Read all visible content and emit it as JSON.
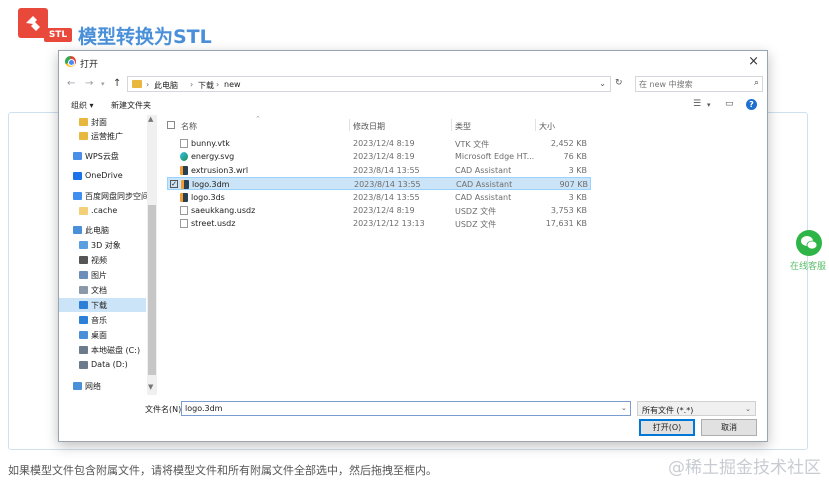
{
  "app": {
    "logo_tag": "STL",
    "title": "模型转换为STL",
    "hint": "如果模型文件包含附属文件，请将模型文件和所有附属文件全部选中，然后拖拽至框内。",
    "watermark": "@稀土掘金技术社区",
    "wechat_label": "在线客服"
  },
  "dialog": {
    "title": "打开",
    "close": "×",
    "nav": {
      "back": "←",
      "forward": "→",
      "up": "↑"
    },
    "breadcrumb": [
      "此电脑",
      "下载",
      "new"
    ],
    "refresh": "↻",
    "search_placeholder": "在 new 中搜索",
    "commands": {
      "organize": "组织 ▾",
      "new_folder": "新建文件夹"
    },
    "sidebar": [
      {
        "label": "封面",
        "icon": "folder-icon",
        "color": "#e8b83e"
      },
      {
        "label": "运营推广",
        "icon": "folder-icon",
        "color": "#e8b83e"
      },
      {
        "label": "WPS云盘",
        "icon": "cloud-icon",
        "color": "#4a8ee8"
      },
      {
        "label": "OneDrive",
        "icon": "onedrive-icon",
        "color": "#1a73e8"
      },
      {
        "label": "百度网盘同步空间",
        "icon": "baidu-icon",
        "color": "#3f8ef0"
      },
      {
        "label": ".cache",
        "icon": "folder-icon",
        "color": "#f3d078"
      },
      {
        "label": "此电脑",
        "icon": "computer-icon",
        "color": "#4a90d9"
      },
      {
        "label": "3D 对象",
        "icon": "3d-objects-icon",
        "color": "#5aa0e0"
      },
      {
        "label": "视频",
        "icon": "video-icon",
        "color": "#555555"
      },
      {
        "label": "图片",
        "icon": "pictures-icon",
        "color": "#6b8fb8"
      },
      {
        "label": "文档",
        "icon": "documents-icon",
        "color": "#8a98aa"
      },
      {
        "label": "下载",
        "icon": "download-icon",
        "color": "#2c7fd6",
        "selected": true
      },
      {
        "label": "音乐",
        "icon": "music-icon",
        "color": "#2c7fd6"
      },
      {
        "label": "桌面",
        "icon": "desktop-icon",
        "color": "#4a90d9"
      },
      {
        "label": "本地磁盘 (C:)",
        "icon": "drive-icon",
        "color": "#6b7b8c"
      },
      {
        "label": "Data (D:)",
        "icon": "drive-icon",
        "color": "#6b7b8c"
      },
      {
        "label": "网络",
        "icon": "network-icon",
        "color": "#4a90d9"
      }
    ],
    "columns": {
      "name": "名称",
      "date": "修改日期",
      "type": "类型",
      "size": "大小"
    },
    "files": [
      {
        "name": "bunny.vtk",
        "date": "2023/12/4 8:19",
        "type": "VTK 文件",
        "size": "2,452 KB",
        "icon": "blank-file-icon"
      },
      {
        "name": "energy.svg",
        "date": "2023/12/4 8:19",
        "type": "Microsoft Edge HT...",
        "size": "76 KB",
        "icon": "edge-icon"
      },
      {
        "name": "extrusion3.wrl",
        "date": "2023/8/14 13:55",
        "type": "CAD Assistant",
        "size": "3 KB",
        "icon": "cad-icon"
      },
      {
        "name": "logo.3dm",
        "date": "2023/8/14 13:55",
        "type": "CAD Assistant",
        "size": "907 KB",
        "icon": "cad-icon",
        "selected": true
      },
      {
        "name": "logo.3ds",
        "date": "2023/8/14 13:55",
        "type": "CAD Assistant",
        "size": "3 KB",
        "icon": "cad-icon"
      },
      {
        "name": "saeukkang.usdz",
        "date": "2023/12/4 8:19",
        "type": "USDZ 文件",
        "size": "3,753 KB",
        "icon": "blank-file-icon"
      },
      {
        "name": "street.usdz",
        "date": "2023/12/12 13:13",
        "type": "USDZ 文件",
        "size": "17,631 KB",
        "icon": "blank-file-icon"
      }
    ],
    "filename_label": "文件名(N):",
    "filename_value": "logo.3dm",
    "filetype_value": "所有文件 (*.*)",
    "open_button": "打开(O)",
    "cancel_button": "取消"
  }
}
